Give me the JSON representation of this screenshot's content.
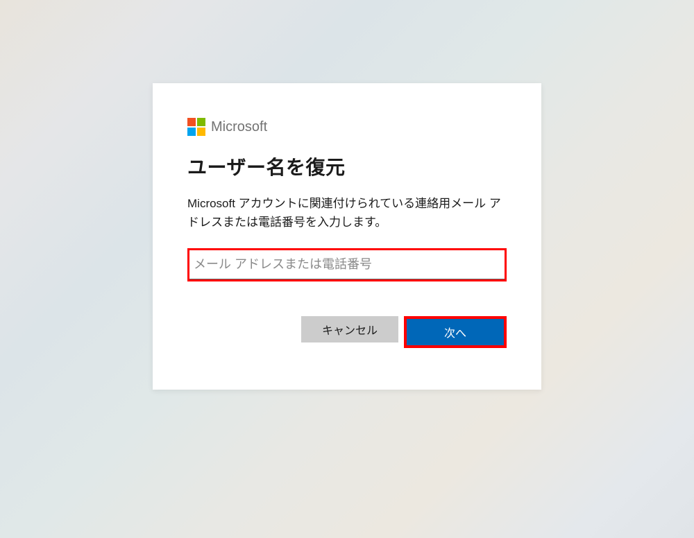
{
  "brand": {
    "name": "Microsoft"
  },
  "dialog": {
    "title": "ユーザー名を復元",
    "description": "Microsoft アカウントに関連付けられている連絡用メール アドレスまたは電話番号を入力します。"
  },
  "input": {
    "placeholder": "メール アドレスまたは電話番号",
    "value": ""
  },
  "buttons": {
    "cancel": "キャンセル",
    "next": "次へ"
  },
  "colors": {
    "highlight": "#ff0000",
    "primary": "#0067b8",
    "secondary": "#cccccc"
  }
}
